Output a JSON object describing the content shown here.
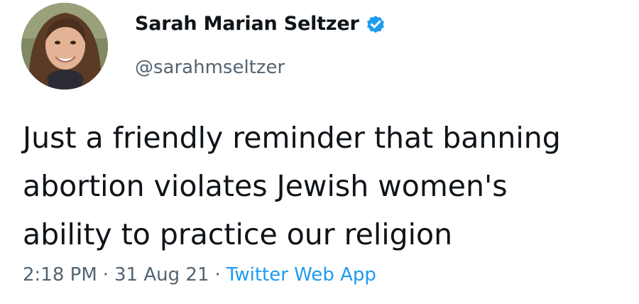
{
  "tweet": {
    "author": {
      "display_name": "Sarah Marian Seltzer",
      "handle": "@sarahmseltzer",
      "verified": true,
      "verified_color": "#1d9bf0",
      "avatar_icon": "profile-photo"
    },
    "text_lines": [
      "Just a friendly reminder that banning",
      "abortion violates Jewish women's",
      "ability to practice our religion"
    ],
    "meta": {
      "time": "2:18 PM",
      "separator": "·",
      "date": "31 Aug 21",
      "source": "Twitter Web App",
      "source_color": "#1d9bf0"
    }
  }
}
